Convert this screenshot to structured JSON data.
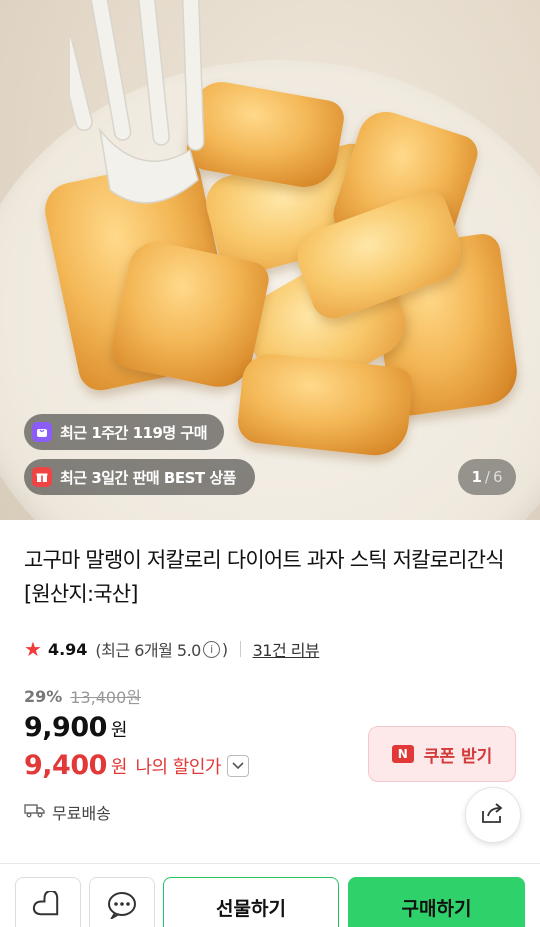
{
  "hero": {
    "badge_recent_buy": "최근 1주간 119명 구매",
    "badge_best": "최근 3일간 판매 BEST 상품",
    "image_counter": {
      "current": "1",
      "separator": "/",
      "total": "6"
    }
  },
  "product": {
    "title": "고구마 말랭이 저칼로리 다이어트 과자 스틱 저칼로리간식 [원산지:국산]"
  },
  "rating": {
    "score": "4.94",
    "recent_text": "(최근 6개월 5.0",
    "recent_close": ")",
    "review_link": "31건 리뷰"
  },
  "price": {
    "discount": "29%",
    "original": "13,400원",
    "current": "9,900",
    "won": "원",
    "my_price": "9,400",
    "my_won": "원",
    "my_label": "나의 할인가"
  },
  "coupon": {
    "badge": "N",
    "label": "쿠폰 받기"
  },
  "shipping": {
    "label": "무료배송"
  },
  "bottom_bar": {
    "gift_label": "선물하기",
    "buy_label": "구매하기"
  },
  "colors": {
    "accent_red": "#e23838",
    "buy_green": "#2fd16b",
    "gift_border": "#23c460",
    "star": "#ef3b3b"
  },
  "icons": [
    "bag-icon",
    "gift-icon",
    "star-icon",
    "info-icon",
    "chevron-down-icon",
    "truck-icon",
    "share-icon",
    "heart-icon",
    "chat-icon"
  ]
}
